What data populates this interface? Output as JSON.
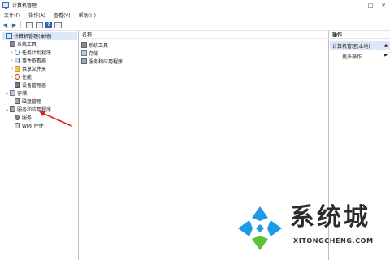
{
  "window": {
    "title": "计算机管理"
  },
  "menu": [
    "文件(F)",
    "操作(A)",
    "查看(V)",
    "帮助(H)"
  ],
  "left_tree": {
    "root": "计算机管理(本地)",
    "system_tools": "系统工具",
    "task_scheduler": "任务计划程序",
    "event_viewer": "事件查看器",
    "shared_folders": "共享文件夹",
    "performance": "性能",
    "device_manager": "设备管理器",
    "storage": "存储",
    "disk_management": "磁盘管理",
    "services_apps": "服务和应用程序",
    "services": "服务",
    "wmi": "WMI 控件"
  },
  "middle": {
    "column_name": "名称",
    "items": [
      "系统工具",
      "存储",
      "服务和应用程序"
    ]
  },
  "actions": {
    "header": "操作",
    "section": "计算机管理(本地)",
    "more": "更多操作"
  },
  "watermark": {
    "title": "系统城",
    "subtitle": "XITONGCHENG.COM"
  },
  "colors": {
    "selection": "#dbe8f7",
    "annotation_red": "#e02020",
    "logo_blue": "#1e9be6",
    "logo_green": "#5cc13b"
  }
}
